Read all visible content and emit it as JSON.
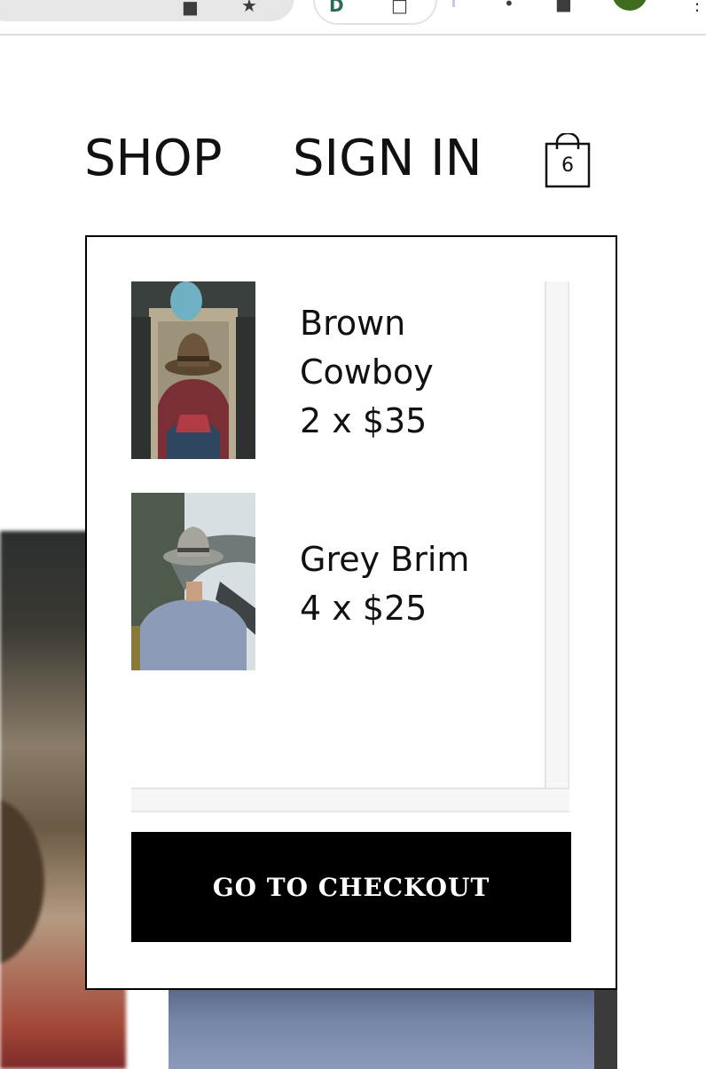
{
  "header": {
    "nav": [
      {
        "label": "SHOP"
      },
      {
        "label": "SIGN IN"
      }
    ],
    "cart_count": "6"
  },
  "cart": {
    "items": [
      {
        "name": "Brown Cowboy",
        "quantity_price": "2 x $35",
        "image": "brown-cowboy-hat-photo"
      },
      {
        "name": "Grey Brim",
        "quantity_price": "4 x $25",
        "image": "grey-brim-hat-photo"
      }
    ],
    "checkout_label": "GO TO CHECKOUT"
  },
  "colors": {
    "text": "#111111",
    "button_bg": "#000000",
    "button_text": "#ffffff",
    "border": "#000000"
  }
}
